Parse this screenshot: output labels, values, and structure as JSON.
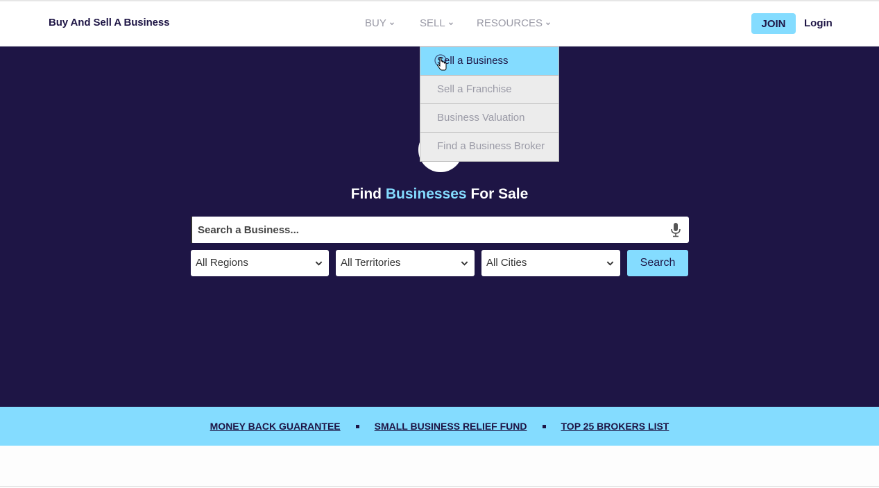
{
  "header": {
    "brand": "Buy And Sell A Business",
    "nav": {
      "buy": "BUY",
      "sell": "SELL",
      "resources": "RESOURCES"
    },
    "join_label": "JOIN",
    "login_label": "Login"
  },
  "sell_dropdown": {
    "items": [
      {
        "label": "Sell a Business",
        "active": true
      },
      {
        "label": "Sell a Franchise"
      },
      {
        "label": "Business Valuation"
      },
      {
        "label": "Find a Business Broker"
      }
    ]
  },
  "hero": {
    "headline_prefix": "Find",
    "headline_highlight": "Businesses",
    "headline_suffix": "For Sale",
    "search_placeholder": "Search a Business...",
    "filters": {
      "regions": "All Regions",
      "territories": "All Territories",
      "cities": "All Cities"
    },
    "search_button": "Search"
  },
  "banner": {
    "links": [
      "MONEY BACK GUARANTEE",
      "SMALL BUSINESS RELIEF FUND",
      "TOP 25 BROKERS LIST"
    ]
  },
  "icons": {
    "microphone": "microphone-icon",
    "chevron": "chevron-down-icon",
    "cursor": "hand-pointer-icon"
  },
  "colors": {
    "brand_dark": "#1e1545",
    "accent": "#84dcff",
    "muted": "#9a9aa6"
  }
}
